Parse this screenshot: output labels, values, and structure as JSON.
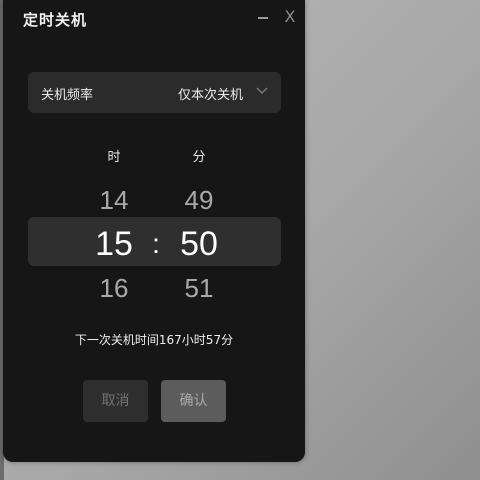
{
  "dialog": {
    "title": "定时关机",
    "window_buttons": {
      "minimize_icon": "minimize-icon",
      "close_icon": "close-icon",
      "close_glyph": "X"
    }
  },
  "frequency": {
    "label": "关机频率",
    "value": "仅本次关机",
    "chevron_icon": "chevron-down-icon"
  },
  "picker": {
    "hour_header": "时",
    "minute_header": "分",
    "hours": {
      "prev": "14",
      "current": "15",
      "next": "16"
    },
    "minutes": {
      "prev": "49",
      "current": "50",
      "next": "51"
    },
    "separator": ":"
  },
  "hint": "下一次关机时间167小时57分",
  "actions": {
    "cancel_label": "取消",
    "confirm_label": "确认"
  },
  "colors": {
    "dialog_bg": "#161616",
    "row_bg": "#2b2b2b",
    "selection_band": "#2f2f2f",
    "confirm_bg": "#5c5c5c",
    "cancel_bg": "#2e2e2e"
  }
}
